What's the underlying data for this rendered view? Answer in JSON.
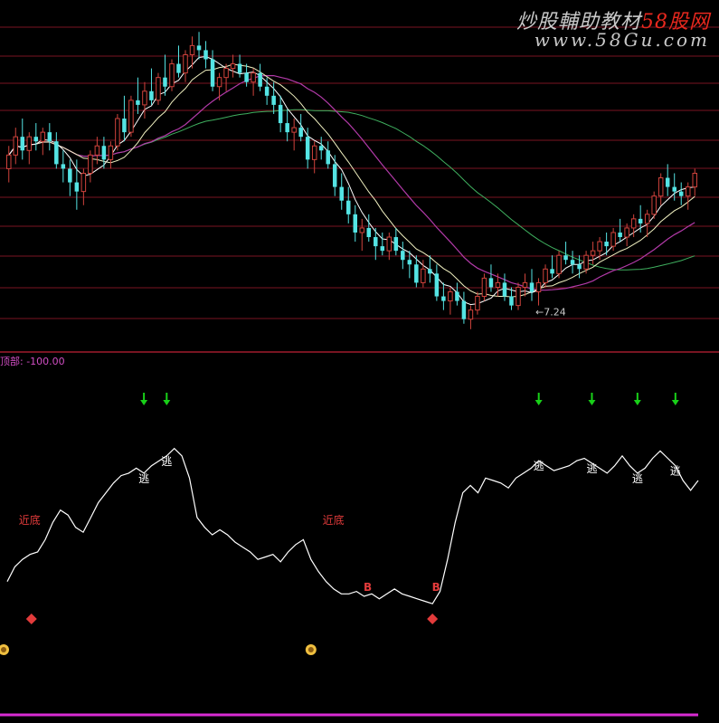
{
  "watermark": {
    "line1a": "炒股輔助教材",
    "line1b": "58股网",
    "line2": "www.58Gu.com"
  },
  "sub_indicator_label": "顶部: -100.00",
  "colors": {
    "up": "#d0433c",
    "down": "#54e4e4",
    "ma_fast": "#ffffff",
    "ma_mid": "#f0f0c0",
    "ma_slow": "#b23aa8",
    "ma_long": "#3fb05f",
    "grid": "#7a1422",
    "osc": "#ffffff",
    "signal_red": "#e23b3b",
    "arrow_green": "#18d018",
    "base_line": "#d82bd2"
  },
  "chart_data": [
    {
      "type": "candlestick",
      "title": "",
      "annotations": [
        {
          "text": "←7.24",
          "at_index": 77,
          "kind": "low_price"
        }
      ],
      "low_price_label": "←7.24",
      "candles": [
        [
          9.0,
          9.25,
          8.85,
          9.15
        ],
        [
          9.15,
          9.45,
          9.05,
          9.35
        ],
        [
          9.35,
          9.55,
          9.1,
          9.2
        ],
        [
          9.2,
          9.4,
          9.05,
          9.35
        ],
        [
          9.35,
          9.5,
          9.2,
          9.3
        ],
        [
          9.3,
          9.45,
          9.15,
          9.4
        ],
        [
          9.4,
          9.5,
          9.2,
          9.3
        ],
        [
          9.3,
          9.4,
          9.0,
          9.05
        ],
        [
          9.05,
          9.2,
          8.85,
          9.0
        ],
        [
          9.0,
          9.1,
          8.7,
          8.85
        ],
        [
          8.85,
          9.1,
          8.55,
          8.75
        ],
        [
          8.75,
          9.0,
          8.6,
          8.95
        ],
        [
          8.95,
          9.2,
          8.85,
          9.15
        ],
        [
          9.15,
          9.35,
          9.05,
          9.25
        ],
        [
          9.25,
          9.35,
          9.0,
          9.1
        ],
        [
          9.1,
          9.3,
          9.0,
          9.25
        ],
        [
          9.25,
          9.6,
          9.2,
          9.55
        ],
        [
          9.55,
          9.8,
          9.3,
          9.4
        ],
        [
          9.4,
          9.8,
          9.35,
          9.75
        ],
        [
          9.75,
          10.0,
          9.6,
          9.7
        ],
        [
          9.7,
          9.95,
          9.55,
          9.85
        ],
        [
          9.85,
          10.1,
          9.7,
          9.75
        ],
        [
          9.75,
          10.05,
          9.7,
          10.0
        ],
        [
          10.0,
          10.25,
          9.8,
          9.9
        ],
        [
          9.9,
          10.2,
          9.85,
          10.15
        ],
        [
          10.15,
          10.35,
          10.0,
          10.05
        ],
        [
          10.05,
          10.3,
          9.95,
          10.25
        ],
        [
          10.25,
          10.45,
          10.1,
          10.35
        ],
        [
          10.35,
          10.5,
          10.2,
          10.3
        ],
        [
          10.3,
          10.4,
          10.1,
          10.2
        ],
        [
          10.2,
          10.3,
          9.85,
          9.9
        ],
        [
          9.9,
          10.05,
          9.75,
          10.0
        ],
        [
          10.0,
          10.15,
          9.85,
          10.1
        ],
        [
          10.1,
          10.25,
          10.0,
          10.15
        ],
        [
          10.15,
          10.25,
          10.0,
          10.05
        ],
        [
          10.05,
          10.15,
          9.9,
          9.95
        ],
        [
          9.95,
          10.1,
          9.8,
          10.05
        ],
        [
          10.05,
          10.15,
          9.85,
          9.9
        ],
        [
          9.9,
          10.0,
          9.7,
          9.8
        ],
        [
          9.8,
          9.95,
          9.6,
          9.7
        ],
        [
          9.7,
          9.8,
          9.4,
          9.5
        ],
        [
          9.5,
          9.65,
          9.3,
          9.4
        ],
        [
          9.4,
          9.55,
          9.2,
          9.45
        ],
        [
          9.45,
          9.6,
          9.3,
          9.35
        ],
        [
          9.35,
          9.45,
          9.0,
          9.1
        ],
        [
          9.1,
          9.3,
          8.95,
          9.25
        ],
        [
          9.25,
          9.35,
          9.1,
          9.2
        ],
        [
          9.2,
          9.3,
          9.0,
          9.05
        ],
        [
          9.05,
          9.15,
          8.7,
          8.8
        ],
        [
          8.8,
          8.95,
          8.55,
          8.65
        ],
        [
          8.65,
          8.8,
          8.4,
          8.5
        ],
        [
          8.5,
          8.6,
          8.2,
          8.3
        ],
        [
          8.3,
          8.45,
          8.1,
          8.35
        ],
        [
          8.35,
          8.5,
          8.2,
          8.25
        ],
        [
          8.25,
          8.35,
          8.0,
          8.15
        ],
        [
          8.15,
          8.3,
          8.05,
          8.1
        ],
        [
          8.1,
          8.3,
          8.0,
          8.25
        ],
        [
          8.25,
          8.35,
          8.05,
          8.1
        ],
        [
          8.1,
          8.2,
          7.9,
          8.0
        ],
        [
          8.0,
          8.1,
          7.8,
          7.95
        ],
        [
          7.95,
          8.05,
          7.7,
          7.75
        ],
        [
          7.75,
          8.0,
          7.7,
          7.9
        ],
        [
          7.9,
          8.05,
          7.75,
          7.85
        ],
        [
          7.85,
          7.95,
          7.55,
          7.6
        ],
        [
          7.6,
          7.75,
          7.45,
          7.55
        ],
        [
          7.55,
          7.7,
          7.4,
          7.65
        ],
        [
          7.65,
          7.75,
          7.5,
          7.55
        ],
        [
          7.55,
          7.65,
          7.3,
          7.35
        ],
        [
          7.35,
          7.5,
          7.24,
          7.45
        ],
        [
          7.45,
          7.65,
          7.4,
          7.6
        ],
        [
          7.6,
          7.85,
          7.55,
          7.8
        ],
        [
          7.8,
          7.95,
          7.65,
          7.7
        ],
        [
          7.7,
          7.85,
          7.6,
          7.75
        ],
        [
          7.75,
          7.85,
          7.55,
          7.6
        ],
        [
          7.6,
          7.7,
          7.45,
          7.5
        ],
        [
          7.5,
          7.75,
          7.45,
          7.7
        ],
        [
          7.7,
          7.85,
          7.6,
          7.75
        ],
        [
          7.75,
          7.9,
          7.55,
          7.65
        ],
        [
          7.65,
          7.8,
          7.5,
          7.75
        ],
        [
          7.75,
          7.95,
          7.7,
          7.9
        ],
        [
          7.9,
          8.05,
          7.8,
          7.85
        ],
        [
          7.85,
          8.1,
          7.8,
          8.05
        ],
        [
          8.05,
          8.2,
          7.95,
          8.0
        ],
        [
          8.0,
          8.1,
          7.85,
          7.95
        ],
        [
          7.95,
          8.05,
          7.8,
          7.9
        ],
        [
          7.9,
          8.1,
          7.85,
          8.05
        ],
        [
          8.05,
          8.2,
          7.95,
          8.1
        ],
        [
          8.1,
          8.25,
          8.0,
          8.2
        ],
        [
          8.2,
          8.3,
          8.05,
          8.15
        ],
        [
          8.15,
          8.35,
          8.1,
          8.3
        ],
        [
          8.3,
          8.45,
          8.2,
          8.25
        ],
        [
          8.25,
          8.4,
          8.15,
          8.35
        ],
        [
          8.35,
          8.5,
          8.25,
          8.45
        ],
        [
          8.45,
          8.6,
          8.3,
          8.4
        ],
        [
          8.4,
          8.55,
          8.25,
          8.5
        ],
        [
          8.5,
          8.75,
          8.45,
          8.7
        ],
        [
          8.7,
          8.95,
          8.6,
          8.9
        ],
        [
          8.9,
          9.05,
          8.7,
          8.8
        ],
        [
          8.8,
          8.95,
          8.65,
          8.75
        ],
        [
          8.75,
          8.85,
          8.6,
          8.7
        ],
        [
          8.7,
          8.85,
          8.55,
          8.8
        ],
        [
          8.8,
          9.0,
          8.7,
          8.95
        ]
      ],
      "ylim": [
        7.0,
        10.85
      ]
    },
    {
      "type": "line",
      "title": "",
      "osc": [
        0.46,
        0.52,
        0.55,
        0.57,
        0.58,
        0.63,
        0.7,
        0.75,
        0.73,
        0.68,
        0.66,
        0.72,
        0.78,
        0.82,
        0.86,
        0.89,
        0.9,
        0.92,
        0.9,
        0.93,
        0.95,
        0.97,
        1.0,
        0.97,
        0.88,
        0.72,
        0.68,
        0.65,
        0.67,
        0.65,
        0.62,
        0.6,
        0.58,
        0.55,
        0.56,
        0.57,
        0.54,
        0.58,
        0.61,
        0.63,
        0.55,
        0.5,
        0.46,
        0.43,
        0.41,
        0.41,
        0.42,
        0.4,
        0.41,
        0.39,
        0.41,
        0.43,
        0.41,
        0.4,
        0.39,
        0.38,
        0.37,
        0.42,
        0.55,
        0.7,
        0.82,
        0.85,
        0.82,
        0.88,
        0.87,
        0.86,
        0.84,
        0.88,
        0.9,
        0.92,
        0.95,
        0.93,
        0.91,
        0.92,
        0.93,
        0.95,
        0.96,
        0.94,
        0.92,
        0.9,
        0.93,
        0.97,
        0.93,
        0.9,
        0.92,
        0.96,
        0.99,
        0.96,
        0.93,
        0.87,
        0.83,
        0.87
      ],
      "ylim": [
        0.0,
        1.05
      ],
      "labels": {
        "escape": "逃",
        "near_bottom": "近底",
        "buy": "B"
      },
      "escape_idx": [
        18,
        21,
        70,
        77,
        83,
        88
      ],
      "near_bottom_idx": [
        2,
        42
      ],
      "buy_idx": [
        47,
        56
      ],
      "up_marker_idx": [
        2,
        56
      ],
      "money_idx": [
        0,
        40
      ]
    }
  ]
}
